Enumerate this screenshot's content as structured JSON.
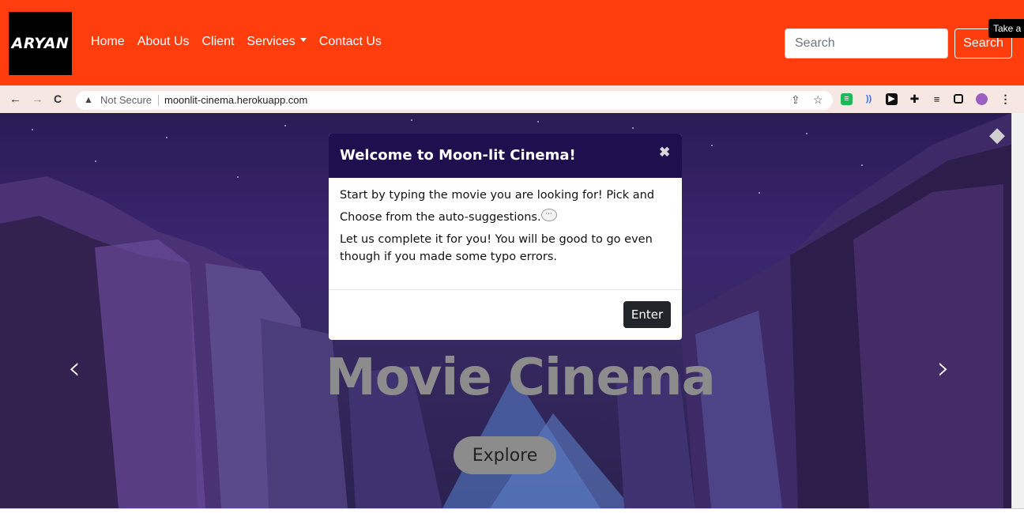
{
  "navbar": {
    "brand": "ARYAN",
    "links": [
      "Home",
      "About Us",
      "Client",
      "Services",
      "Contact Us"
    ],
    "search_placeholder": "Search",
    "search_button": "Search",
    "tooltip": "Take a"
  },
  "browser": {
    "security": "Not Secure",
    "url": "moonlit-cinema.herokuapp.com"
  },
  "hero": {
    "title": "Movie Cinema",
    "explore_button": "Explore"
  },
  "modal": {
    "title": "Welcome to Moon-lit Cinema!",
    "close_symbol": "✖",
    "body_line1": "Start by typing the movie you are looking for! Pick and",
    "body_line2": "Choose from the auto-suggestions.",
    "body_line3": "Let us complete it for you! You will be good to go even",
    "body_line4": "though if you made some typo errors.",
    "enter_button": "Enter"
  },
  "colors": {
    "navbar": "#ff3d0d",
    "modal_header": "#1f0f4f",
    "hero_bg": "#35285f"
  }
}
